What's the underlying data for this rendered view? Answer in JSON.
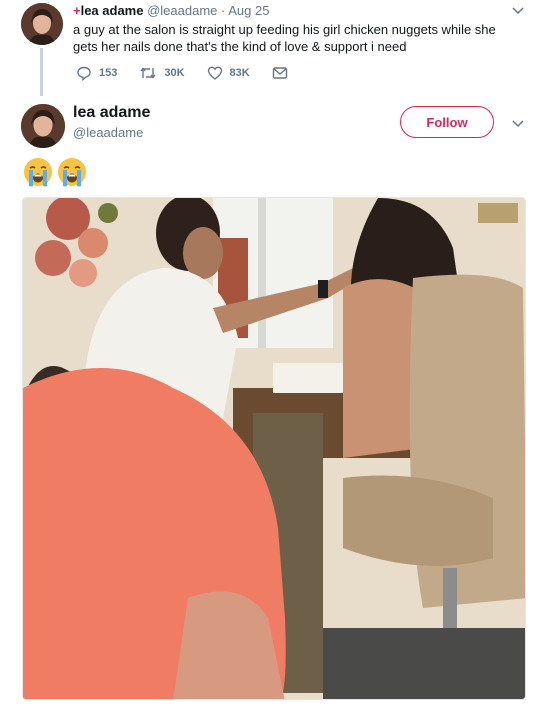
{
  "tweet": {
    "plus_sign": "+",
    "author_name": "lea adame",
    "handle": "@leaadame",
    "separator": "·",
    "date": "Aug 25",
    "text": "a guy at the salon is straight up feeding his girl chicken nuggets while she gets her nails done that's the kind of love & support i need",
    "replies": "153",
    "retweets": "30K",
    "likes": "83K",
    "icons": [
      "reply-icon",
      "retweet-icon",
      "like-icon",
      "message-icon",
      "chevron-down-icon"
    ]
  },
  "reply_tweet": {
    "author_name": "lea adame",
    "handle": "@leaadame",
    "follow_label": "Follow",
    "emojis": [
      "loudly-crying-face",
      "loudly-crying-face"
    ]
  },
  "colors": {
    "brand_pink": "#e0245e",
    "muted_text": "#657786",
    "text": "#14171a",
    "thread_line": "#cbd3da"
  }
}
